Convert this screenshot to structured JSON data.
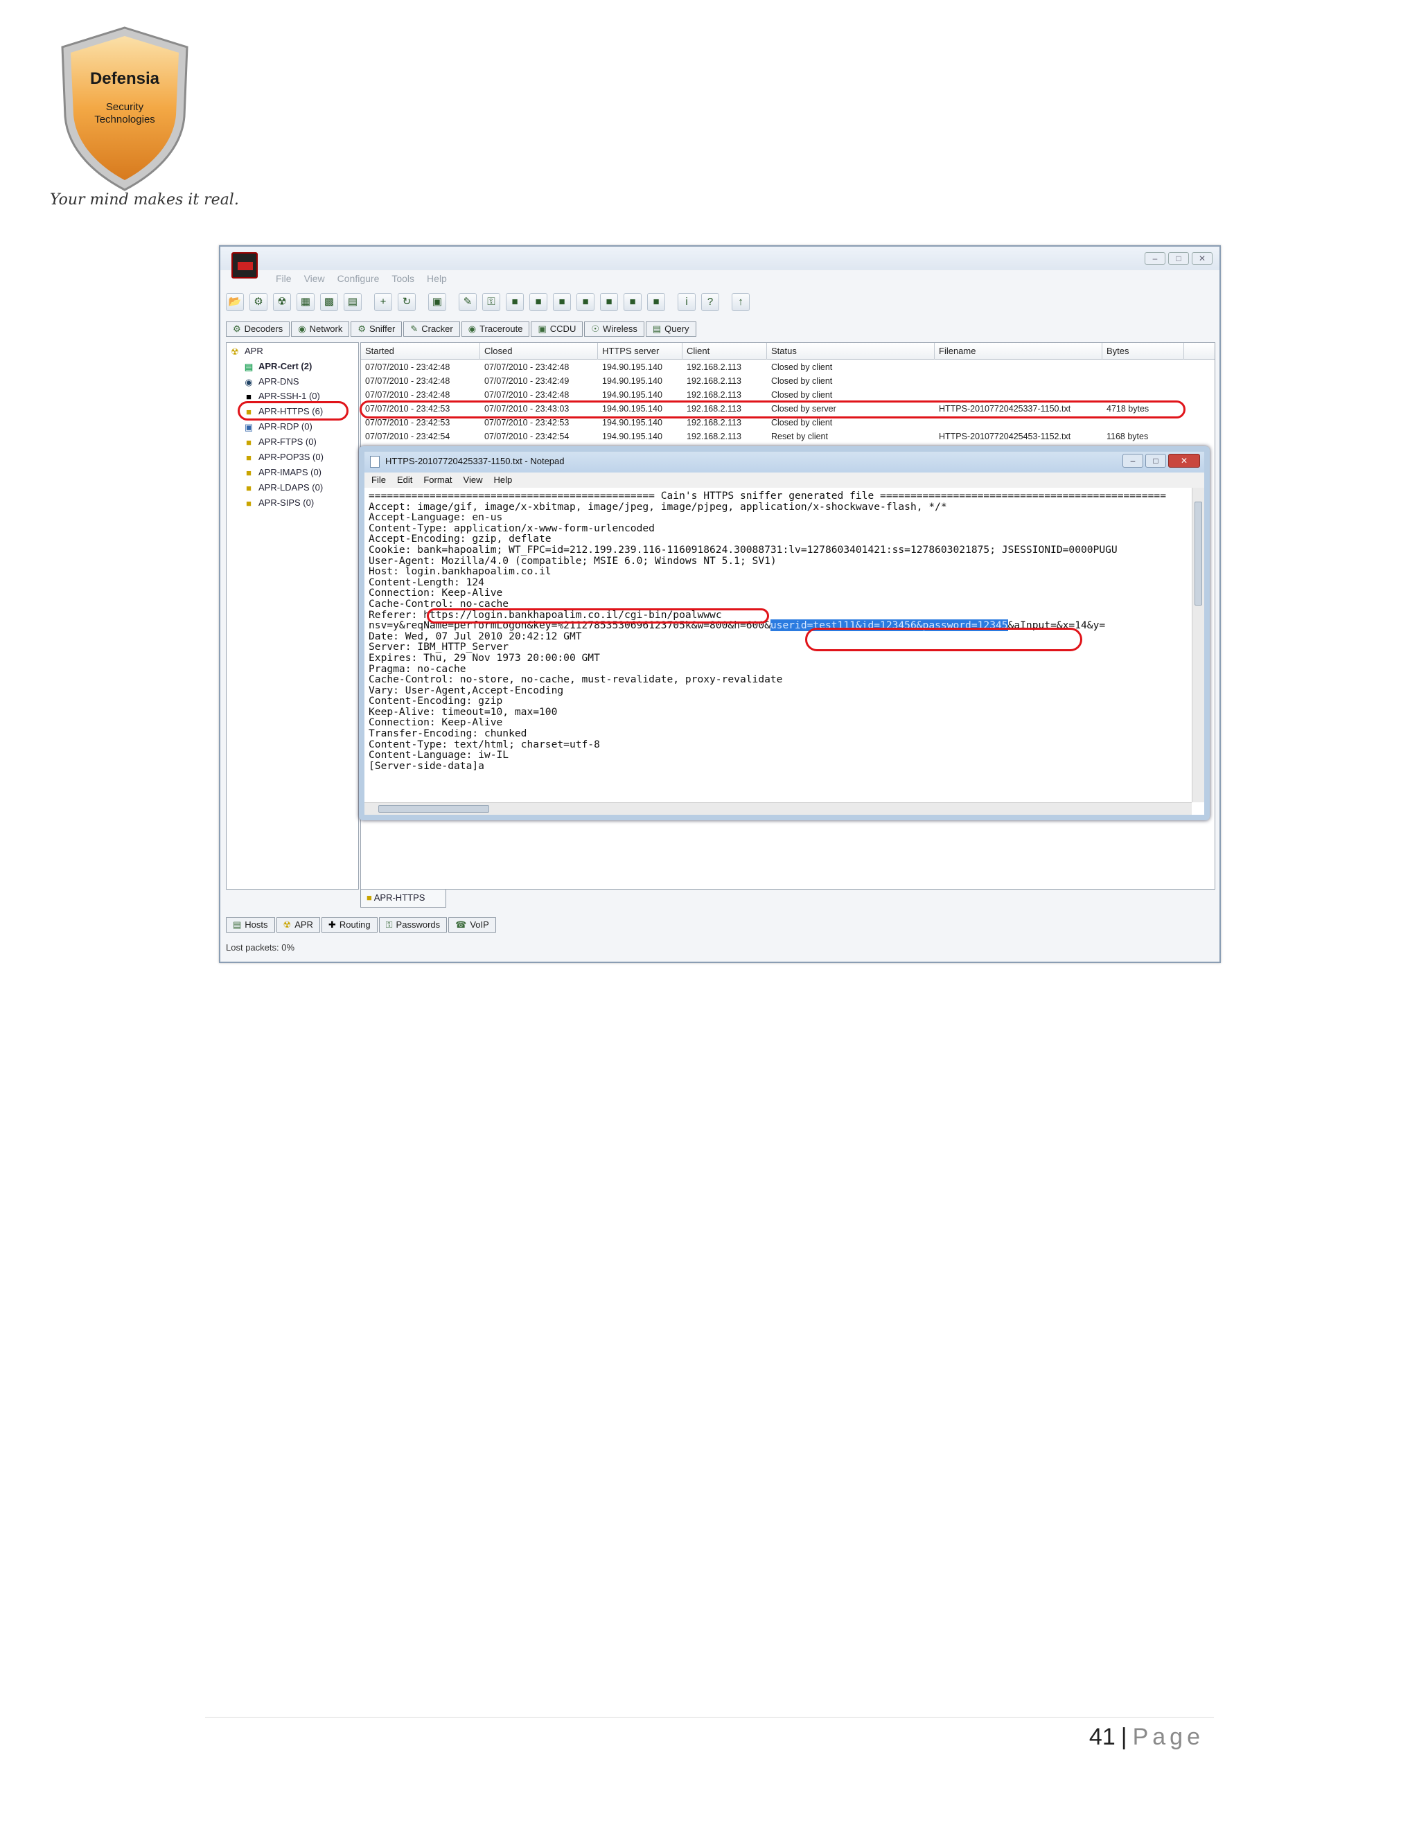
{
  "logo": {
    "title": "Defensia",
    "subtitle_line1": "Security",
    "subtitle_line2": "Technologies",
    "tagline": "Your mind makes it real."
  },
  "app": {
    "menu": [
      "File",
      "View",
      "Configure",
      "Tools",
      "Help"
    ],
    "top_tabs": [
      "Decoders",
      "Network",
      "Sniffer",
      "Cracker",
      "Traceroute",
      "CCDU",
      "Wireless",
      "Query"
    ],
    "tree": [
      {
        "label": "APR",
        "bold": false
      },
      {
        "label": "APR-Cert (2)",
        "bold": true
      },
      {
        "label": "APR-DNS",
        "bold": false
      },
      {
        "label": "APR-SSH-1 (0)",
        "bold": false
      },
      {
        "label": "APR-HTTPS (6)",
        "bold": false
      },
      {
        "label": "APR-RDP (0)",
        "bold": false
      },
      {
        "label": "APR-FTPS (0)",
        "bold": false
      },
      {
        "label": "APR-POP3S (0)",
        "bold": false
      },
      {
        "label": "APR-IMAPS (0)",
        "bold": false
      },
      {
        "label": "APR-LDAPS (0)",
        "bold": false
      },
      {
        "label": "APR-SIPS (0)",
        "bold": false
      }
    ],
    "columns": [
      "Started",
      "Closed",
      "HTTPS server",
      "Client",
      "Status",
      "Filename",
      "Bytes"
    ],
    "rows": [
      [
        "07/07/2010 - 23:42:48",
        "07/07/2010 - 23:42:48",
        "194.90.195.140",
        "192.168.2.113",
        "Closed by client",
        "",
        ""
      ],
      [
        "07/07/2010 - 23:42:48",
        "07/07/2010 - 23:42:49",
        "194.90.195.140",
        "192.168.2.113",
        "Closed by client",
        "",
        ""
      ],
      [
        "07/07/2010 - 23:42:48",
        "07/07/2010 - 23:42:48",
        "194.90.195.140",
        "192.168.2.113",
        "Closed by client",
        "",
        ""
      ],
      [
        "07/07/2010 - 23:42:53",
        "07/07/2010 - 23:43:03",
        "194.90.195.140",
        "192.168.2.113",
        "Closed by server",
        "HTTPS-20107720425337-1150.txt",
        "4718 bytes"
      ],
      [
        "07/07/2010 - 23:42:53",
        "07/07/2010 - 23:42:53",
        "194.90.195.140",
        "192.168.2.113",
        "Closed by client",
        "",
        ""
      ],
      [
        "07/07/2010 - 23:42:54",
        "07/07/2010 - 23:42:54",
        "194.90.195.140",
        "192.168.2.113",
        "Reset by client",
        "HTTPS-20107720425453-1152.txt",
        "1168 bytes"
      ]
    ],
    "bottom_tab": "APR-HTTPS",
    "lower_tabs": [
      "Hosts",
      "APR",
      "Routing",
      "Passwords",
      "VoIP"
    ],
    "status": "Lost packets:  0%"
  },
  "notepad": {
    "title": "HTTPS-20107720425337-1150.txt - Notepad",
    "menu": [
      "File",
      "Edit",
      "Format",
      "View",
      "Help"
    ],
    "line01": "=============================================== Cain's HTTPS sniffer generated file ===============================================",
    "line02": "Accept: image/gif, image/x-xbitmap, image/jpeg, image/pjpeg, application/x-shockwave-flash, */*",
    "line03": "Accept-Language: en-us",
    "line04": "Content-Type: application/x-www-form-urlencoded",
    "line05": "Accept-Encoding: gzip, deflate",
    "line06": "Cookie: bank=hapoalim; WT_FPC=id=212.199.239.116-1160918624.30088731:lv=1278603401421:ss=1278603021875; JSESSIONID=0000PUGU",
    "line07": "User-Agent: Mozilla/4.0 (compatible; MSIE 6.0; Windows NT 5.1; SV1)",
    "line08": "Host: login.bankhapoalim.co.il",
    "line09": "Content-Length: 124",
    "line10": "Connection: Keep-Alive",
    "line11": "Cache-Control: no-cache",
    "line12_key": "Referer: ",
    "line12_val": "https://login.bankhapoalim.co.il/cgi-bin/poalwwwc",
    "line13": "",
    "line14_a": "nsv=y&reqName=performLogon&key=%21127853530696123705k&w=800&h=600&",
    "line14_hl": "userid=test111&id=123456&password=12345",
    "line14_b": "&aInput=&x=14&y=",
    "line15": "Date: Wed, 07 Jul 2010 20:42:12 GMT",
    "line16": "Server: IBM_HTTP_Server",
    "line17": "Expires: Thu, 29 Nov 1973 20:00:00 GMT",
    "line18": "Pragma: no-cache",
    "line19": "Cache-Control: no-store, no-cache, must-revalidate, proxy-revalidate",
    "line20": "Vary: User-Agent,Accept-Encoding",
    "line21": "Content-Encoding: gzip",
    "line22": "Keep-Alive: timeout=10, max=100",
    "line23": "Connection: Keep-Alive",
    "line24": "Transfer-Encoding: chunked",
    "line25": "Content-Type: text/html; charset=utf-8",
    "line26": "Content-Language: iw-IL",
    "line27": "",
    "line28": "[Server-side-data]a"
  },
  "footer": {
    "page_number": "41",
    "separator": "|",
    "page_label": "Page"
  },
  "colors": {
    "annotation_red": "#e0141a",
    "selection_blue": "#2b7be0",
    "shield_gold": "#f0a23a"
  }
}
